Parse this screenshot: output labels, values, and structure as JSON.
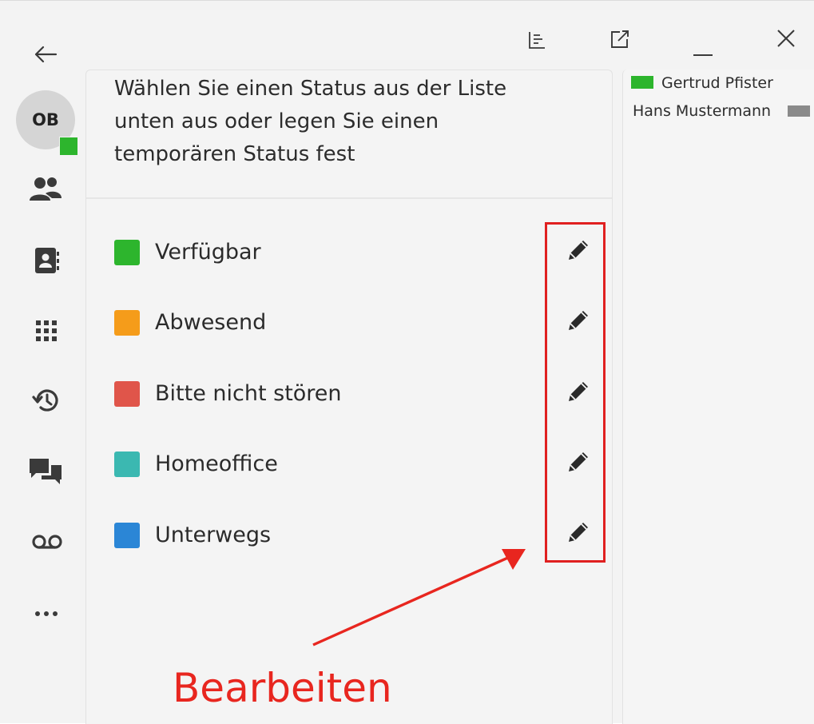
{
  "window": {
    "back_icon": "arrow-left-icon",
    "toolbar_icons": [
      "list-icon",
      "external-link-icon",
      "minimize-icon",
      "close-icon"
    ]
  },
  "user": {
    "initials": "OB",
    "status_color": "#2db52d"
  },
  "sidebar": {
    "items": [
      {
        "icon": "contacts-icon"
      },
      {
        "icon": "address-book-icon"
      },
      {
        "icon": "dialpad-icon"
      },
      {
        "icon": "history-icon"
      },
      {
        "icon": "chat-icon"
      },
      {
        "icon": "voicemail-icon"
      },
      {
        "icon": "more-icon"
      }
    ]
  },
  "main": {
    "intro_lines": [
      "Wählen Sie einen Status aus der Liste",
      "unten aus oder legen Sie einen",
      "temporären Status fest"
    ],
    "statuses": [
      {
        "label": "Verfügbar",
        "color": "#2db52d"
      },
      {
        "label": "Abwesend",
        "color": "#f59c1a"
      },
      {
        "label": "Bitte nicht stören",
        "color": "#e0554a"
      },
      {
        "label": "Homeoffice",
        "color": "#3bb8b1"
      },
      {
        "label": "Unterwegs",
        "color": "#2b86d6"
      }
    ]
  },
  "annotation": {
    "label": "Bearbeiten",
    "color": "#e8261f"
  },
  "contacts": [
    {
      "name": "Gertrud Pfister",
      "status_color": "#2db52d"
    },
    {
      "name": "Hans Mustermann",
      "status_color": "#8a8a8a"
    }
  ]
}
